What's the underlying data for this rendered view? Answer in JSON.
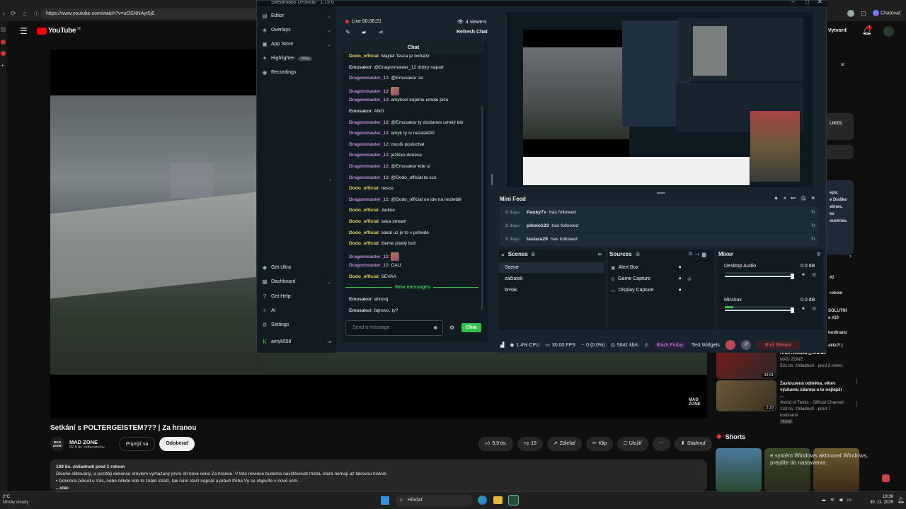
{
  "browser": {
    "url": "https://www.youtube.com/watch?v=uOSNNAyt5jE",
    "profile_label": "Chatovať"
  },
  "youtube": {
    "logo": "YouTube",
    "logo_sup": "SK",
    "create_label": "Vytvoriť",
    "notif_count": "1",
    "video_title": "Setkání s POLTERGEISTEM??? | Za hranou",
    "channel_name": "MAD ZONE",
    "channel_subs": "82,8 tis. odberateľov",
    "join_label": "Pripojiť sa",
    "subscribe_label": "Odoberať",
    "like_count": "9,9 tis.",
    "dislike_count": "15",
    "share_label": "Zdieľať",
    "clip_label": "Klip",
    "save_label": "Uložiť",
    "download_label": "Stiahnuť",
    "watermark": "MAD ZONE",
    "desc_stats": "109 tis. zhliadnutí  pred 1 rokom",
    "desc_line1": "Dlouho slibovaný, a později dokonce omylem vymazaný první díl nové série Za hranou.  V této novince budeme navštěvovat místa, která nemají až takovou historii.",
    "desc_line2": "• Dokonce pokud u Vás, nebo někde kde to znáte straší, tak nám stačí napsat a právě třeba Vy se objevíte v nové sérii.",
    "desc_more": "...viac",
    "shorts_label": "Shorts",
    "side_frag": [
      {
        "t": "LIKES"
      },
      {
        "t": "eps:"
      },
      {
        "t": "e Dislike"
      },
      {
        "t": "elines,"
      },
      {
        "t": "ks"
      },
      {
        "t": "ountries."
      },
      {
        "t": "#2"
      },
      {
        "t": "rokom"
      },
      {
        "t": "SOLUTNÍ"
      },
      {
        "t": "e #10"
      },
      {
        "t": "hodinami"
      },
      {
        "t": "akla?! |"
      }
    ],
    "recs": [
      {
        "title": "Hrad Houska @Vidrail",
        "channel": "MAD ZONE",
        "meta": "531 tis. zhliadnutí · pred 2 rokmi",
        "duration": "33:01"
      },
      {
        "title": "Zaslouzená odměna, větev výzkumu zdarma a to nejlepší ...",
        "channel": "World of Tanks - Official Channel",
        "meta": "133 tis. zhliadnutí · pred 7 hodinami",
        "duration": "2:23",
        "badge": "Nové"
      }
    ],
    "shorts_caption": "e systém Windows aktivovať Windows, prejdite do nastavenia."
  },
  "streamlabs": {
    "window_title": "Streamlabs Desktop - 1.19.6",
    "nav": [
      {
        "label": "Editor",
        "icon": "editor-icon",
        "chev": true
      },
      {
        "label": "Overlays",
        "icon": "overlays-icon",
        "chev": true
      },
      {
        "label": "App Store",
        "icon": "app-store-icon",
        "chev": true
      },
      {
        "label": "Highlighter",
        "icon": "highlighter-icon",
        "beta": "beta"
      },
      {
        "label": "Recordings",
        "icon": "recordings-icon"
      }
    ],
    "nav_bottom": [
      {
        "label": "Get Ultra",
        "icon": "ultra-icon"
      },
      {
        "label": "Dashboard",
        "icon": "dashboard-icon",
        "chev": true
      },
      {
        "label": "Get Help",
        "icon": "help-icon"
      },
      {
        "label": "AI",
        "icon": "ai-icon"
      },
      {
        "label": "Settings",
        "icon": "settings-icon"
      }
    ],
    "user": "amyk558",
    "live": "Live 00:08:21",
    "viewers": "4 viewers",
    "refresh_chat": "Refresh Chat",
    "chat_header": "Chat",
    "messages": [
      {
        "user": "Dodo_official",
        "cls": "dodo",
        "text": "Majitel Tesca je bohatší"
      },
      {
        "user": "Emusakor",
        "cls": "emu",
        "text": "@Dragonmaster_12 dobry napad"
      },
      {
        "user": "Dragonmaster_12",
        "cls": "drag",
        "text": "@Emusakor 2e"
      },
      {
        "user": "Dragonmaster_12",
        "cls": "drag",
        "text": "",
        "emote": true
      },
      {
        "user": "Dragonmaster_12",
        "cls": "drag",
        "text": "amykovi kúpime umelú piču"
      },
      {
        "user": "Emusakor",
        "cls": "emu",
        "text": "ANO"
      },
      {
        "user": "Dragonmaster_12",
        "cls": "drag",
        "text": "@Emusakor ty dostanes umelý kár"
      },
      {
        "user": "Dragonmaster_12",
        "cls": "drag",
        "text": "amyk ty si nezasklžiš"
      },
      {
        "user": "Dragonmaster_12",
        "cls": "drag",
        "text": "musiš posluchat"
      },
      {
        "user": "Dragonmaster_12",
        "cls": "drag",
        "text": "ježiško donese"
      },
      {
        "user": "Dragonmaster_12",
        "cls": "drag",
        "text": "@Emusakor kde si"
      },
      {
        "user": "Dragonmaster_12",
        "cls": "drag",
        "text": "@Dodo_official ta sce"
      },
      {
        "user": "Dodo_official",
        "cls": "dodo",
        "text": "nesce"
      },
      {
        "user": "Dragonmaster_12",
        "cls": "drag",
        "text": "@Dodo_official on ide na nezletilé"
      },
      {
        "user": "Dodo_official",
        "cls": "dodo",
        "text": "Jedine"
      },
      {
        "user": "Dodo_official",
        "cls": "dodo",
        "text": "seka stream"
      },
      {
        "user": "Dodo_official",
        "cls": "dodo",
        "text": "sekal uz je to v pohode"
      },
      {
        "user": "Dodo_official",
        "cls": "dodo",
        "text": "čierne pixely boli"
      },
      {
        "user": "Dragonmaster_12",
        "cls": "drag",
        "text": "",
        "emote": true
      },
      {
        "user": "Dragonmaster_12",
        "cls": "drag",
        "text": "CAU"
      },
      {
        "user": "Dodo_official",
        "cls": "dodo",
        "text": "SEVAA"
      }
    ],
    "new_messages": "New messages",
    "new_msgs": [
      {
        "user": "Emusakor",
        "cls": "emu",
        "text": "ahoooj"
      },
      {
        "user": "Emusakor",
        "cls": "emu",
        "text": "fajnovo, ty?"
      }
    ],
    "chat_placeholder": "Send a message",
    "chat_button": "Chat",
    "mini_feed_title": "Mini Feed",
    "feed": [
      {
        "days": "8 days",
        "user": "PaukyTv",
        "action": "has followed"
      },
      {
        "days": "8 days",
        "user": "pikolo123",
        "action": "has followed"
      },
      {
        "days": "9 days",
        "user": "tastara29",
        "action": "has followed"
      }
    ],
    "scenes_title": "Scenes",
    "scenes": [
      "Scene",
      "začiatok",
      "break"
    ],
    "sources_title": "Sources",
    "sources": [
      {
        "name": "Alert Box",
        "icon": "alert-box-icon"
      },
      {
        "name": "Game Capture",
        "icon": "game-capture-icon"
      },
      {
        "name": "Display Capture",
        "icon": "display-capture-icon"
      }
    ],
    "mixer_title": "Mixer",
    "mixer": [
      {
        "name": "Desktop Audio",
        "db": "0.0 dB",
        "level": 0.0
      },
      {
        "name": "Mic/Aux",
        "db": "0.0 dB",
        "level": 0.12
      }
    ],
    "cpu": "1.4% CPU",
    "fps": "30.00 FPS",
    "dropped": "0 (0.0%)",
    "kbps": "5641 kb/s",
    "black_friday": "Black Friday",
    "test_widgets": "Test Widgets",
    "end_stream": "End Stream"
  },
  "taskbar": {
    "temp": "2°C",
    "weather": "Mostly cloudy",
    "search": "Hľadať",
    "time": "19:36",
    "date": "30. 11. 2025"
  }
}
